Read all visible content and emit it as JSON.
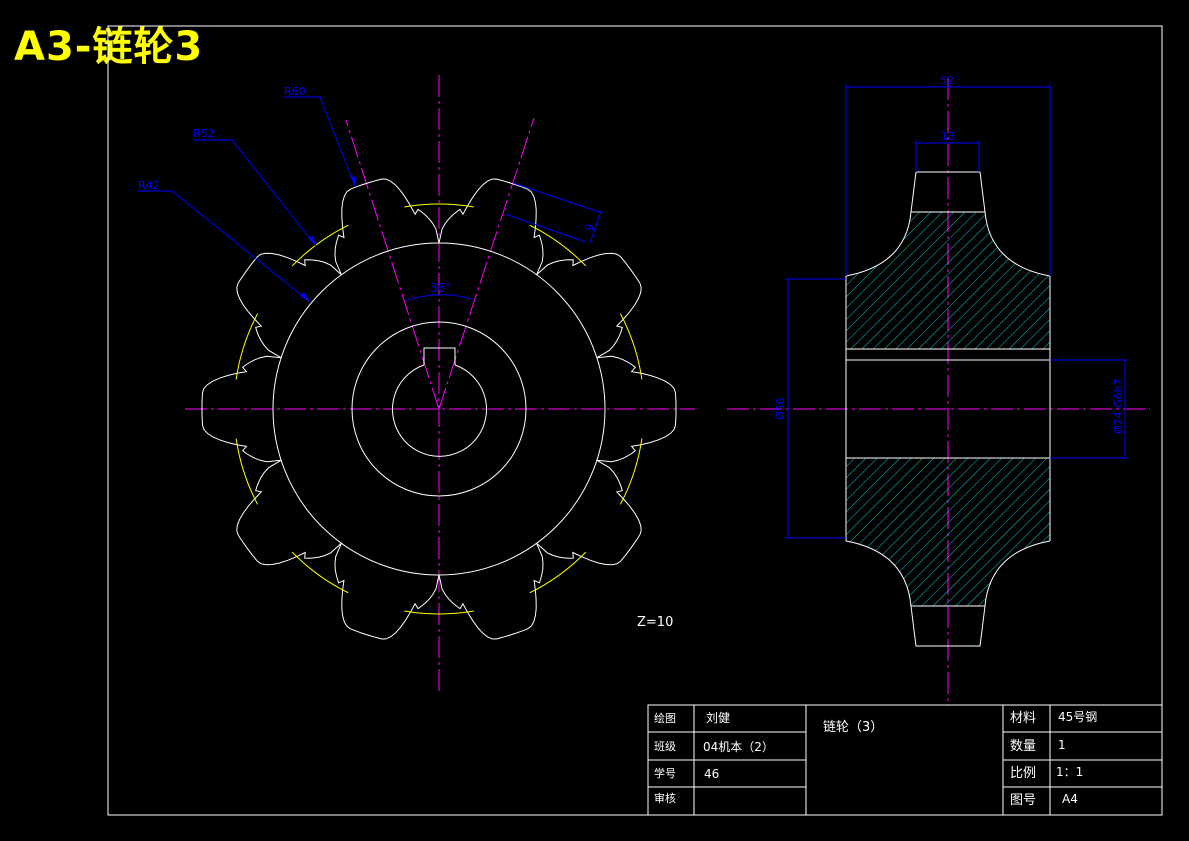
{
  "title": "A3-链轮3",
  "colors": {
    "background": "#000000",
    "outline": "#ffffff",
    "centerline": "#ff00ff",
    "dimension": "#0000ff",
    "pitch_circle": "#ffff00",
    "hatch": "#00ffff",
    "title": "#ffff00"
  },
  "labels": {
    "r60": "R60",
    "r52": "R52",
    "r42": "R42",
    "angle": "36°",
    "tooth_dim": "9",
    "width": "52",
    "hub_width": "18",
    "dia_outer": "Ø56",
    "dia_bore": "Ø24 G6h7",
    "teeth": "Z=10"
  },
  "title_block": {
    "drawn_label": "绘图",
    "drawn_value": "刘健",
    "class_label": "班级",
    "class_value": "04机本（2）",
    "id_label": "学号",
    "id_value": "46",
    "review_label": "审核",
    "part_name": "链轮（3）",
    "material_label": "材料",
    "material_value": "45号钢",
    "qty_label": "数量",
    "qty_value": "1",
    "scale_label": "比例",
    "scale_value": "1：1",
    "sheet_label": "图号",
    "sheet_value": "A4"
  }
}
